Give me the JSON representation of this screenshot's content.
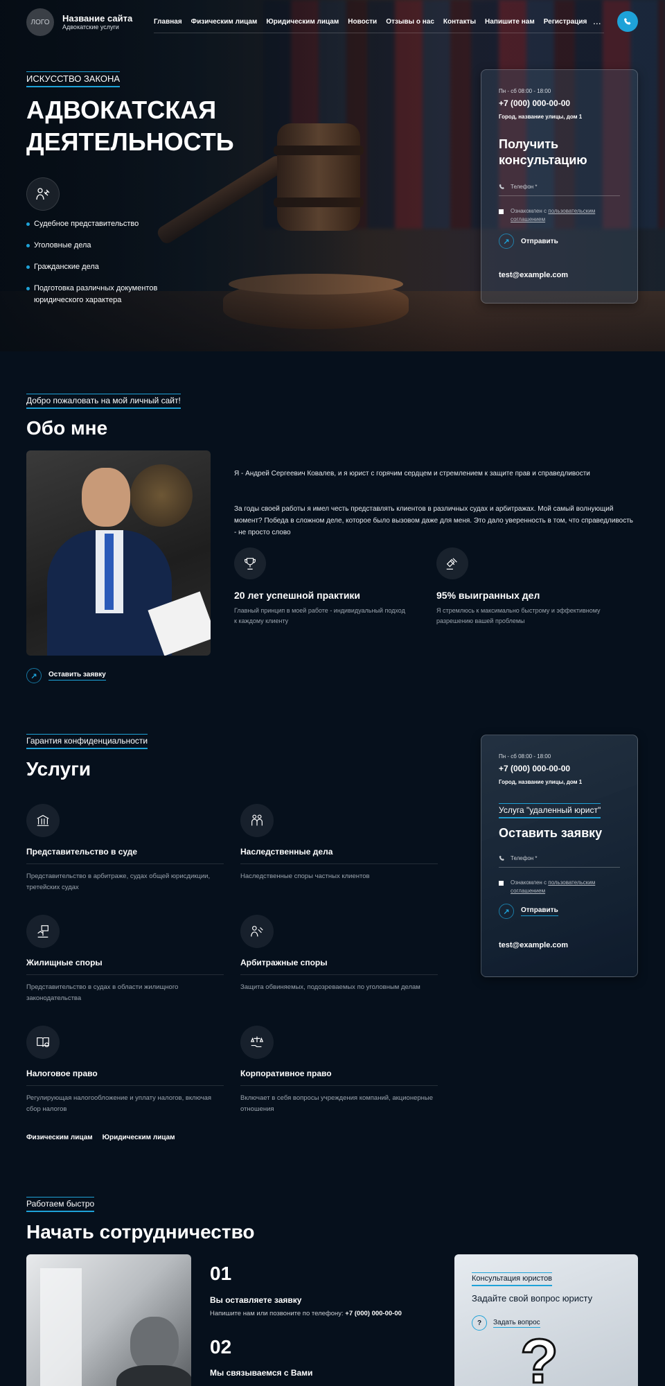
{
  "header": {
    "logo": "ЛОГО",
    "site_title": "Название сайта",
    "site_subtitle": "Адвокатские услуги",
    "nav": [
      "Главная",
      "Физическим лицам",
      "Юридическим лицам",
      "Новости",
      "Отзывы о нас",
      "Контакты",
      "Напишите нам",
      "Регистрация"
    ],
    "more": "..."
  },
  "hero": {
    "eyebrow": "ИСКУССТВО ЗАКОНА",
    "title": "АДВОКАТСКАЯ ДЕЯТЕЛЬНОСТЬ",
    "list": [
      "Судебное представительство",
      "Уголовные дела",
      "Гражданские дела",
      "Подготовка различных документов юридического характера"
    ]
  },
  "contact_card": {
    "hours": "Пн - сб 08:00 - 18:00",
    "phone": "+7 (000) 000-00-00",
    "address": "Город, название улицы, дом 1",
    "title": "Получить консультацию",
    "phone_placeholder": "Телефон *",
    "agree_text": "Ознакомлен с ",
    "agree_link": "пользовательским соглашением",
    "send": "Отправить",
    "email": "test@example.com"
  },
  "about": {
    "eyebrow": "Добро пожаловать на мой личный сайт!",
    "title": "Обо мне",
    "p1": "Я - Андрей Сергеевич Ковалев, и я юрист с горячим сердцем и стремлением к защите прав и справедливости",
    "p2": "За годы своей работы я имел честь представлять клиентов в различных судах и арбитражах. Мой самый волнующий момент? Победа в сложном деле, которое было вызовом даже для меня. Это дало уверенность в том, что справедливость - не просто слово",
    "features": [
      {
        "title": "20 лет успешной практики",
        "text": "Главный принцип в моей работе - индивидуальный подход к каждому клиенту"
      },
      {
        "title": "95% выигранных дел",
        "text": "Я стремлюсь к максимально быстрому и эффективному разрешению вашей проблемы"
      }
    ],
    "cta": "Оставить заявку"
  },
  "services": {
    "eyebrow": "Гарантия конфиденциальности",
    "title": "Услуги",
    "items": [
      {
        "title": "Представительство в суде",
        "text": "Представительство в арбитраже, судах общей юрисдикции, третейских судах"
      },
      {
        "title": "Наследственные дела",
        "text": "Наследственные споры частных клиентов"
      },
      {
        "title": "Жилищные споры",
        "text": "Представительство в судах в области жилищного законодательства"
      },
      {
        "title": "Арбитражные споры",
        "text": "Защита обвиняемых, подозреваемых по уголовным делам"
      },
      {
        "title": "Налоговое право",
        "text": "Регулирующая налогообложение и уплату налогов, включая сбор налогов"
      },
      {
        "title": "Корпоративное право",
        "text": "Включает в себя вопросы учреждения компаний, акционерные отношения"
      }
    ],
    "links": [
      "Физическим лицам",
      "Юридическим лицам"
    ]
  },
  "request_card": {
    "hours": "Пн - сб 08:00 - 18:00",
    "phone": "+7 (000) 000-00-00",
    "address": "Город, название улицы, дом 1",
    "eyebrow": "Услуга \"удаленный юрист\"",
    "title": "Оставить заявку",
    "phone_placeholder": "Телефон *",
    "agree_text": "Ознакомлен с ",
    "agree_link": "пользовательским соглашением",
    "send": "Отправить",
    "email": "test@example.com"
  },
  "start": {
    "eyebrow": "Работаем быстро",
    "title": "Начать сотрудничество",
    "steps": [
      {
        "n": "01",
        "title": "Вы оставляете заявку",
        "text": "Напишите нам или позвоните по телефону: ",
        "phone": "+7 (000) 000-00-00"
      },
      {
        "n": "02",
        "title": "Мы связываемся с Вами"
      }
    ],
    "consult": {
      "eyebrow": "Консультация юристов",
      "title": "Задайте свой вопрос юристу",
      "button": "Задать вопрос"
    }
  },
  "colors": {
    "accent": "#1ea2d8",
    "background": "#06101c"
  }
}
